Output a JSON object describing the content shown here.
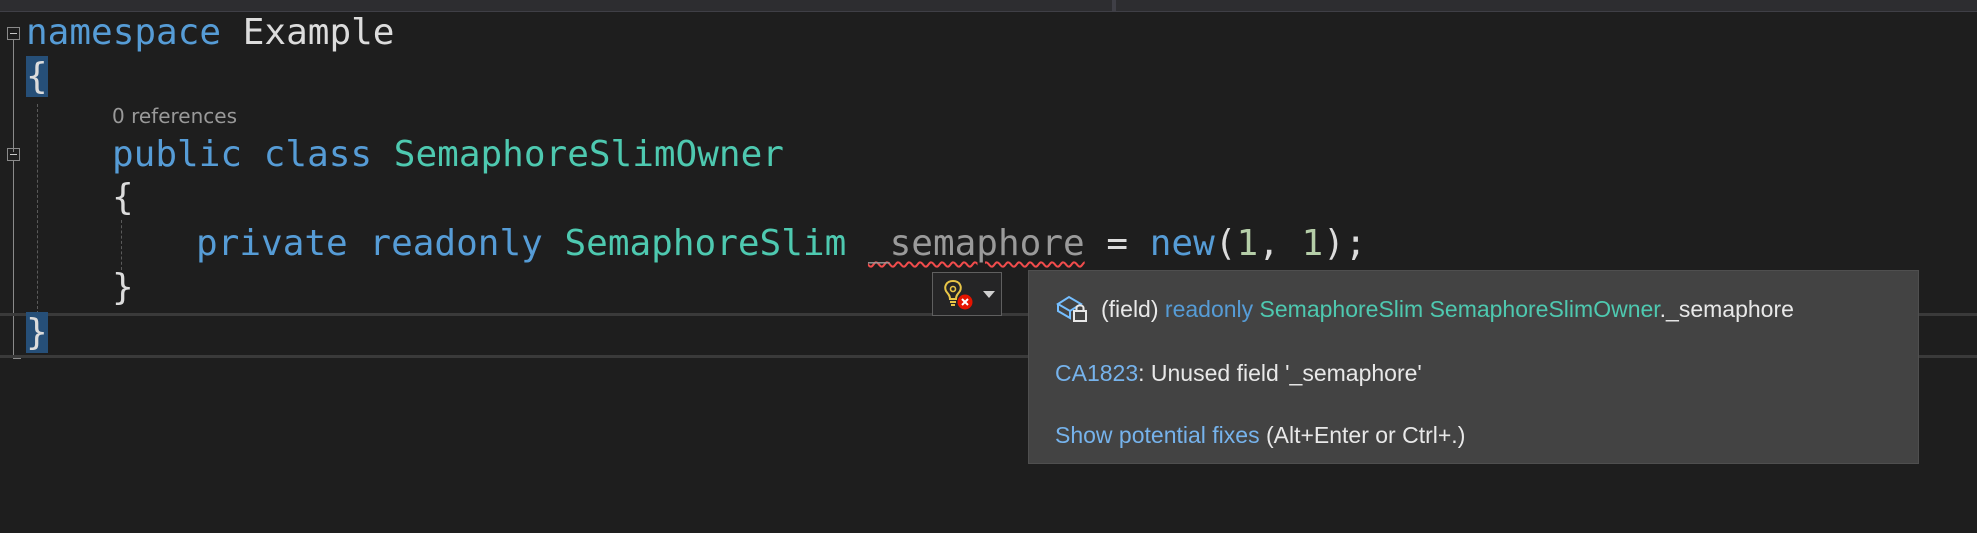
{
  "editor": {
    "codelens": "0 references",
    "lines": {
      "l1": {
        "kw": "namespace",
        "name": " Example"
      },
      "l2": {
        "brace": "{"
      },
      "l3": {
        "kw1": "public",
        "kw2": "class",
        "type": "SemaphoreSlimOwner"
      },
      "l4": {
        "brace": "{"
      },
      "l5": {
        "kw1": "private",
        "kw2": "readonly",
        "type": "SemaphoreSlim",
        "field": "_semaphore",
        "eq": " = ",
        "newkw": "new",
        "open": "(",
        "n1": "1",
        "comma": ", ",
        "n2": "1",
        "close": ");"
      },
      "l6": {
        "brace": "}"
      },
      "l7": {
        "brace": "}"
      }
    }
  },
  "lightbulb": {
    "icon": "lightbulb-error-icon",
    "dropdown_icon": "chevron-down-icon"
  },
  "quickinfo": {
    "icon": "field-readonly-icon",
    "sig_prefix": "(field) ",
    "sig_kw": "readonly",
    "sig_type": "SemaphoreSlim",
    "sig_owner": "SemaphoreSlimOwner",
    "sig_member": "._semaphore",
    "diag_code": "CA1823",
    "diag_text": ": Unused field '_semaphore'",
    "fix_link": "Show potential fixes",
    "fix_shortcut": " (Alt+Enter or Ctrl+.)"
  },
  "colors": {
    "keyword": "#569cd6",
    "type": "#4ec9b0",
    "number": "#b5cea8",
    "link": "#76b3ec",
    "squiggle": "#f14c4c"
  }
}
